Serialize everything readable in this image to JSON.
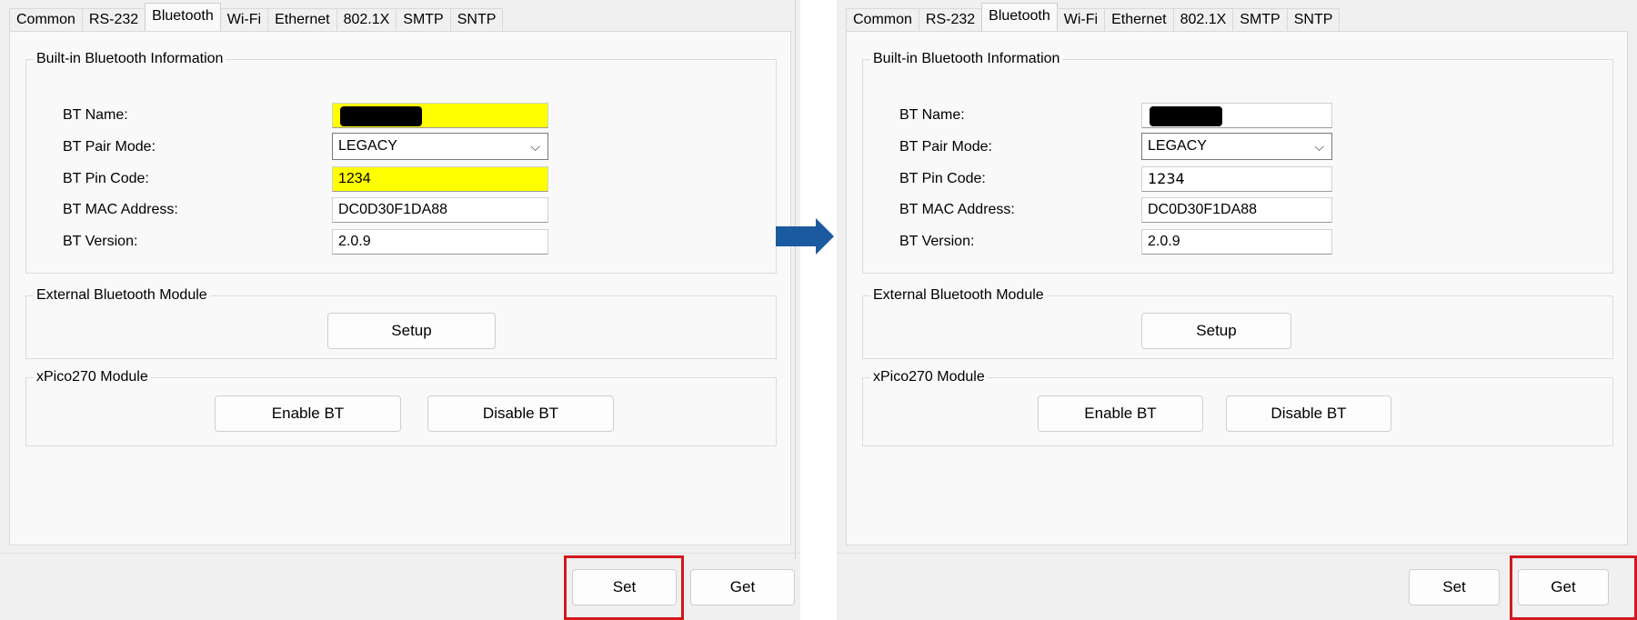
{
  "tabs": [
    "Common",
    "RS-232",
    "Bluetooth",
    "Wi-Fi",
    "Ethernet",
    "802.1X",
    "SMTP",
    "SNTP"
  ],
  "active_tab": "Bluetooth",
  "builtin": {
    "legend": "Built-in Bluetooth Information",
    "name_label": "BT Name:",
    "pair_label": "BT Pair Mode:",
    "pin_label": "BT Pin Code:",
    "mac_label": "BT MAC Address:",
    "version_label": "BT Version:"
  },
  "before": {
    "bt_name_value": "",
    "pair_mode": "LEGACY",
    "pin_code": "1234",
    "mac_address": "DC0D30F1DA88",
    "version": "2.0.9",
    "modified_field_color": "#ffff00"
  },
  "after": {
    "bt_name_value": "",
    "pair_mode": "LEGACY",
    "pin_code": "1234",
    "mac_address": "DC0D30F1DA88",
    "version": "2.0.9"
  },
  "external": {
    "legend": "External Bluetooth Module",
    "setup_label": "Setup"
  },
  "xpico": {
    "legend": "xPico270 Module",
    "enable_label": "Enable BT",
    "disable_label": "Disable BT"
  },
  "footer": {
    "set_label": "Set",
    "get_label": "Get"
  },
  "annotations": {
    "highlight_color": "#d5171e",
    "arrow_color": "#1c5aa0",
    "left_highlighted_button": "Set",
    "right_highlighted_button": "Get"
  }
}
